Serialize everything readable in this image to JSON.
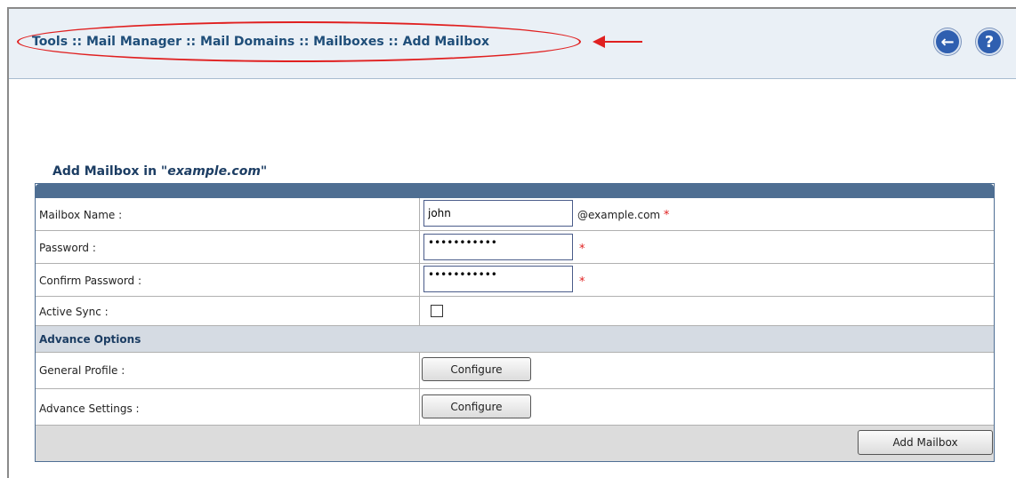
{
  "header": {
    "breadcrumb": "Tools :: Mail Manager :: Mail Domains :: Mailboxes :: Add Mailbox",
    "back_icon": "arrow-left-circle-icon",
    "help_icon": "question-circle-icon",
    "back_glyph": "←",
    "help_glyph": "?"
  },
  "form": {
    "title_prefix": "Add Mailbox in ",
    "title_domain": "\"example.com\"",
    "fields": {
      "mailbox_name_label": "Mailbox Name :",
      "mailbox_name_value": "john",
      "domain_suffix": "@example.com",
      "password_label": "Password :",
      "password_value": "•••••••••••",
      "confirm_password_label": "Confirm Password :",
      "confirm_password_value": "•••••••••••",
      "active_sync_label": "Active Sync :",
      "active_sync_checked": false,
      "required_mark": "*"
    },
    "advance": {
      "heading": "Advance Options",
      "general_profile_label": "General Profile :",
      "advance_settings_label": "Advance Settings :",
      "configure_label": "Configure"
    },
    "submit_label": "Add Mailbox"
  },
  "colors": {
    "highlight": "#e02020",
    "breadcrumb_text": "#1f4e79",
    "panel_header": "#4e6e92"
  }
}
